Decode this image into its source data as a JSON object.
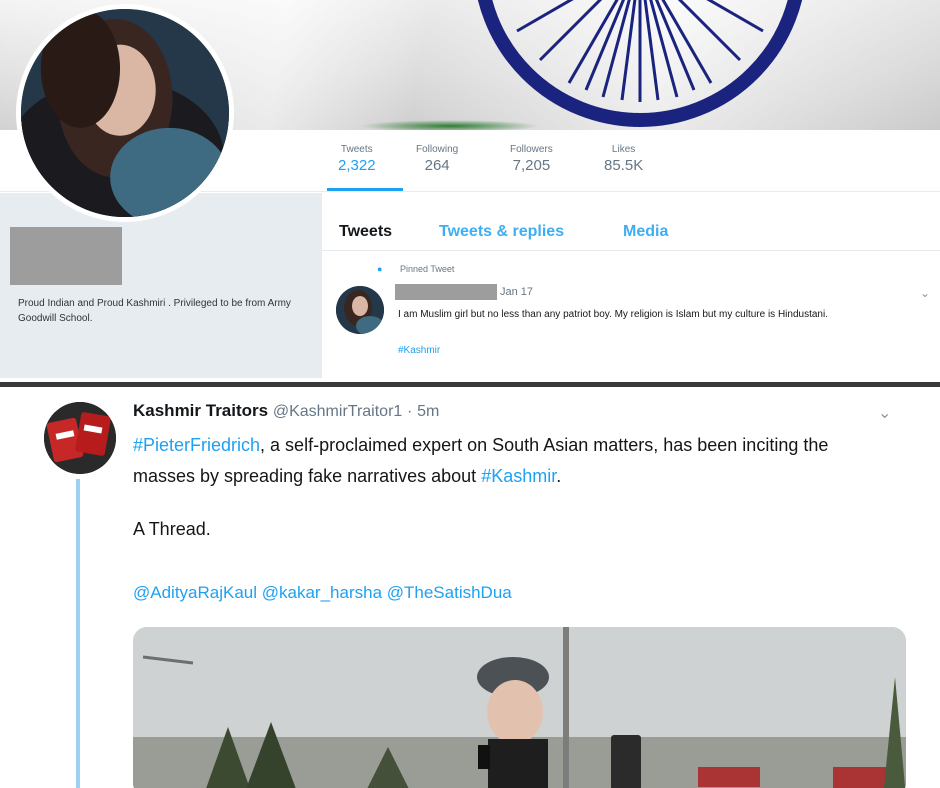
{
  "profile": {
    "stats": [
      {
        "label": "Tweets",
        "value": "2,322"
      },
      {
        "label": "Following",
        "value": "264"
      },
      {
        "label": "Followers",
        "value": "7,205"
      },
      {
        "label": "Likes",
        "value": "85.5K"
      }
    ],
    "bio": "Proud Indian and Proud Kashmiri . Privileged to be from Army Goodwill School.",
    "tabs": [
      "Tweets",
      "Tweets & replies",
      "Media"
    ],
    "pinned": {
      "label": "Pinned Tweet",
      "date": "Jan 17",
      "text": "I am Muslim girl but no less than any patriot boy. My religion is Islam but my culture is Hindustani.",
      "hashtag": "#Kashmir"
    }
  },
  "tweet": {
    "author": "Kashmir Traitors",
    "handle": "@KashmirTraitor1",
    "separator": "·",
    "time": "5m",
    "body_tag1": "#PieterFriedrich",
    "body_text1": ", a self-proclaimed expert on South Asian matters, has been inciting the masses by spreading fake narratives about ",
    "body_tag2": "#Kashmir",
    "body_end": ".",
    "thread_label": "A Thread.",
    "mentions": "@AdityaRajKaul @kakar_harsha @TheSatishDua"
  },
  "colors": {
    "link": "#1da1f2",
    "muted": "#657786",
    "thread_line": "#9fd0f3"
  },
  "icons": {
    "chevron": "chevron-down-icon",
    "pin": "pin-icon"
  }
}
